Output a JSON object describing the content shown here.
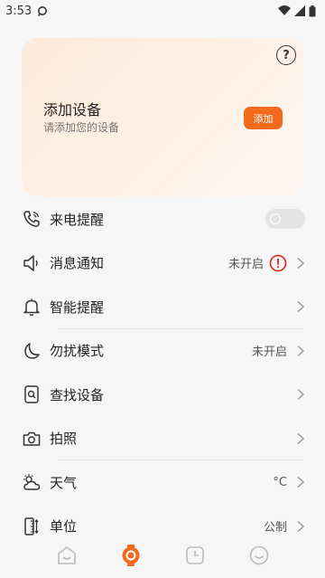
{
  "status_bar": {
    "time": "3:53",
    "icons": [
      "sync-icon",
      "wifi-icon",
      "signal-icon",
      "battery-icon"
    ]
  },
  "device_card": {
    "title": "添加设备",
    "subtitle": "请添加您的设备",
    "add_label": "添加",
    "help_glyph": "?",
    "accent_color": "#f26b1d"
  },
  "menu": {
    "items": [
      {
        "label": "来电提醒",
        "icon": "phone-icon",
        "control": "toggle",
        "toggle_on": false
      },
      {
        "label": "消息通知",
        "icon": "speaker-icon",
        "value": "未开启",
        "alert": true
      },
      {
        "label": "智能提醒",
        "icon": "bell-icon"
      },
      {
        "label": "勿扰模式",
        "icon": "moon-icon",
        "value": "未开启"
      },
      {
        "label": "查找设备",
        "icon": "find-device-icon"
      },
      {
        "label": "拍照",
        "icon": "camera-icon"
      },
      {
        "label": "天气",
        "icon": "weather-icon",
        "value": "°C"
      },
      {
        "label": "单位",
        "icon": "ruler-icon",
        "value": "公制"
      }
    ]
  },
  "bottom_nav": {
    "tabs": [
      "home-tab-icon",
      "device-tab-icon",
      "clock-tab-icon",
      "profile-tab-icon"
    ],
    "active_index": 1,
    "active_color": "#f26b1d",
    "inactive_color": "#bbbbbb"
  }
}
